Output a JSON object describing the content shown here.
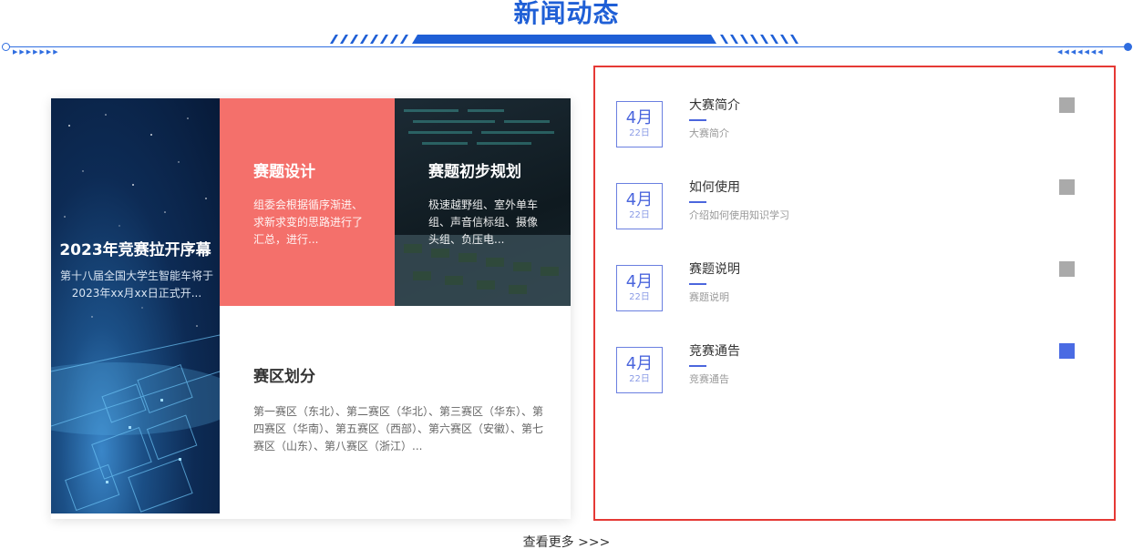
{
  "header": {
    "title": "新闻动态"
  },
  "mosaic": {
    "space": {
      "title": "2023年竞赛拉开序幕",
      "body": "第十八届全国大学生智能车将于2023年xx月xx日正式开..."
    },
    "design": {
      "title": "赛题设计",
      "body": "组委会根据循序渐进、求新求变的思路进行了汇总，进行..."
    },
    "plan": {
      "title": "赛题初步规划",
      "body": "极速越野组、室外单车组、声音信标组、摄像头组、负压电..."
    },
    "zones": {
      "title": "赛区划分",
      "body": "第一赛区（东北）、第二赛区（华北）、第三赛区（华东）、第四赛区（华南）、第五赛区（西部）、第六赛区（安徽）、第七赛区（山东）、第八赛区（浙江）..."
    }
  },
  "more_link": "查看更多 >>>",
  "news": [
    {
      "month": "4月",
      "day": "22日",
      "title": "大赛简介",
      "desc": "大赛简介",
      "active": false
    },
    {
      "month": "4月",
      "day": "22日",
      "title": "如何使用",
      "desc": "介绍如何使用知识学习",
      "active": false
    },
    {
      "month": "4月",
      "day": "22日",
      "title": "赛题说明",
      "desc": "赛题说明",
      "active": false
    },
    {
      "month": "4月",
      "day": "22日",
      "title": "竞赛通告",
      "desc": "竞赛通告",
      "active": true
    }
  ],
  "colors": {
    "accent": "#1f5fd6",
    "tile_red": "#f4706b",
    "panel_border": "#e53935",
    "square_inactive": "#aaaaaa",
    "square_active": "#4a6be3"
  }
}
